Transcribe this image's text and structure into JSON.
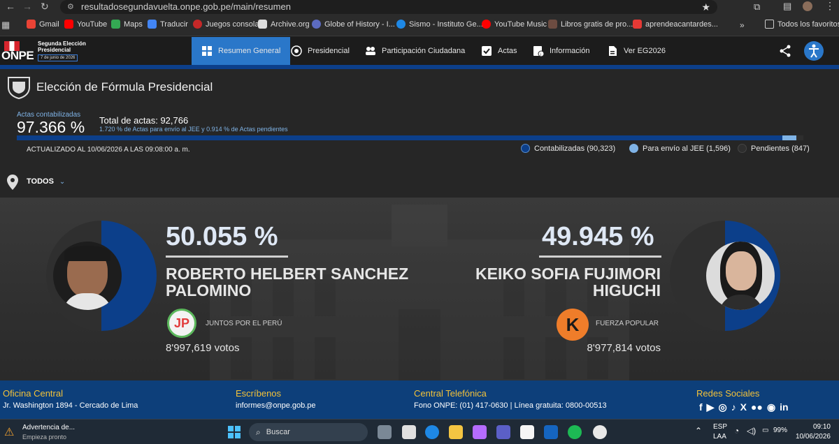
{
  "browser": {
    "url": "resultadosegundavuelta.onpe.gob.pe/main/resumen",
    "bookmarks": [
      {
        "label": "Gmail",
        "color": "#ea4335"
      },
      {
        "label": "YouTube",
        "color": "#ff0000"
      },
      {
        "label": "Maps",
        "color": "#34a853"
      },
      {
        "label": "Traducir",
        "color": "#4285f4"
      },
      {
        "label": "Juegos consola",
        "color": "#c62828"
      },
      {
        "label": "Archive.org",
        "color": "#dddddd"
      },
      {
        "label": "Globe of History - I...",
        "color": "#5c6bc0"
      },
      {
        "label": "Sismo - Instituto Ge...",
        "color": "#1e88e5"
      },
      {
        "label": "YouTube Music",
        "color": "#ff0000"
      },
      {
        "label": "Libros gratis de pro...",
        "color": "#6d4c41"
      },
      {
        "label": "aprendeacantardes...",
        "color": "#e53935"
      }
    ],
    "all_bookmarks": "Todos los favoritos"
  },
  "site": {
    "logo_text": "ONPE",
    "logo_sub1": "Segunda Elección",
    "logo_sub2": "Presidencial",
    "logo_date": "7 de junio de 2026",
    "nav": [
      {
        "label": "Resumen General",
        "icon": "grid-icon",
        "active": true
      },
      {
        "label": "Presidencial",
        "icon": "seal-icon"
      },
      {
        "label": "Participación Ciudadana",
        "icon": "people-icon"
      },
      {
        "label": "Actas",
        "icon": "check-icon"
      },
      {
        "label": "Información",
        "icon": "info-icon"
      },
      {
        "label": "Ver EG2026",
        "icon": "document-icon"
      }
    ]
  },
  "election": {
    "title": "Elección de Fórmula Presidencial",
    "actas_label": "Actas contabilizadas",
    "actas_pct": "97.366 %",
    "total_label": "Total de actas: 92,766",
    "subnote": "1.720 % de Actas para envío al JEE y 0.914 % de Actas pendientes",
    "updated": "ACTUALIZADO AL 10/06/2026 A LAS 09:08:00 a. m.",
    "progress": {
      "counted": 0.97366,
      "jee": 0.0172,
      "pending": 0.00914
    },
    "legend": [
      {
        "label": "Contabilizadas (90,323)",
        "color": "#0c3f8a"
      },
      {
        "label": "Para envío al JEE (1,596)",
        "color": "#7fb3e6"
      },
      {
        "label": "Pendientes (847)",
        "color": "#2e2e2e"
      }
    ],
    "filter": "TODOS"
  },
  "candidates": [
    {
      "pct": "50.055 %",
      "name1": "ROBERTO HELBERT SANCHEZ",
      "name2": "PALOMINO",
      "party": "JUNTOS POR EL PERÚ",
      "votes": "8'997,619 votos"
    },
    {
      "pct": "49.945 %",
      "name1": "KEIKO SOFIA FUJIMORI",
      "name2": "HIGUCHI",
      "party": "FUERZA POPULAR",
      "votes": "8'977,814 votos"
    }
  ],
  "footer": {
    "office_h": "Oficina Central",
    "office_t": "Jr. Washington 1894 - Cercado de Lima",
    "mail_h": "Escríbenos",
    "mail_t": "informes@onpe.gob.pe",
    "phone_h": "Central Telefónica",
    "phone_t": "Fono ONPE: (01) 417-0630 | Línea gratuita: 0800-00513",
    "social_h": "Redes Sociales"
  },
  "taskbar": {
    "alert1": "Advertencia de...",
    "alert2": "Empieza pronto",
    "search": "Buscar",
    "lang1": "ESP",
    "lang2": "LAA",
    "battery": "99%",
    "time": "09:10",
    "date": "10/06/2026"
  }
}
